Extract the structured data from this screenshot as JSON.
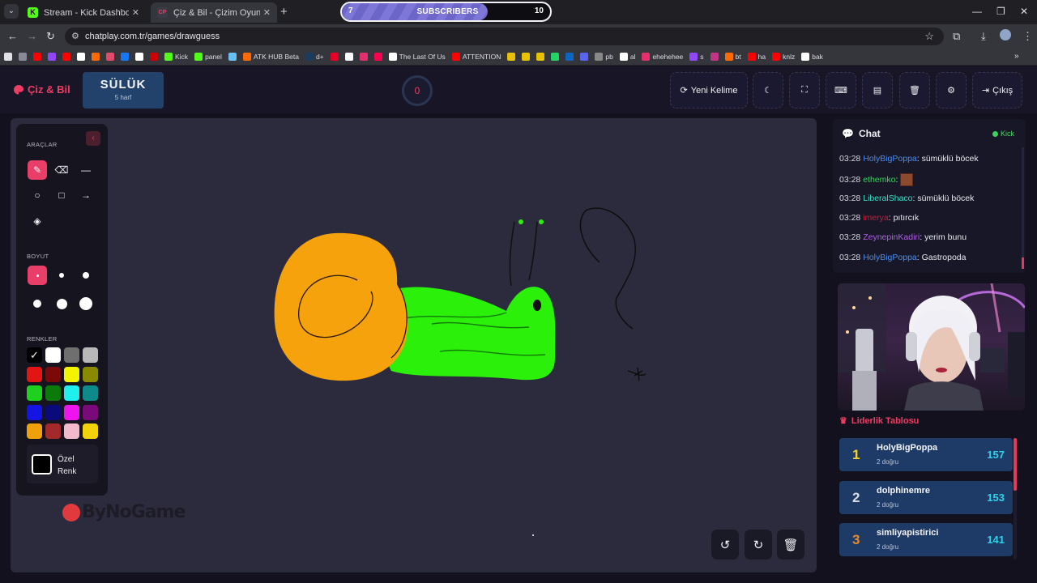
{
  "browser": {
    "tabs": [
      {
        "title": "Stream - Kick Dashboard",
        "favicon": "kick-icon",
        "color": "#53fc18",
        "active": false
      },
      {
        "title": "Çiz & Bil - Çizim Oyunu",
        "favicon": "chatplay-icon",
        "color": "#e83e67",
        "active": true
      }
    ],
    "subscribers": {
      "label": "SUBSCRIBERS",
      "current": "7",
      "goal": "10",
      "progress": 0.7
    },
    "url": "chatplay.com.tr/games/drawguess",
    "bookmarks": [
      {
        "label": "",
        "color": "#ff0000"
      },
      {
        "label": "",
        "color": "#9146ff"
      },
      {
        "label": "",
        "color": "#ff0000"
      },
      {
        "label": "",
        "color": "#ffffff"
      },
      {
        "label": "",
        "color": "#ff6a00"
      },
      {
        "label": "",
        "color": "#e34b6a"
      },
      {
        "label": "",
        "color": "#1877f2"
      },
      {
        "label": "",
        "color": "#ffffff"
      },
      {
        "label": "",
        "color": "#cc0000"
      },
      {
        "label": "Kick",
        "color": "#53fc18"
      },
      {
        "label": "panel",
        "color": "#53fc18"
      },
      {
        "label": "",
        "color": "#66c0f4"
      },
      {
        "label": "ATK HUB Beta",
        "color": "#ff6a00"
      },
      {
        "label": "d+",
        "color": "#1a3d5d"
      },
      {
        "label": "",
        "color": "#e60023"
      },
      {
        "label": "",
        "color": "#ffffff"
      },
      {
        "label": "",
        "color": "#e1306c"
      },
      {
        "label": "",
        "color": "#ff0050"
      },
      {
        "label": "The Last Of Us",
        "color": "#ffffff"
      },
      {
        "label": "ATTENTION",
        "color": "#ff0000"
      },
      {
        "label": "",
        "color": "#e6c200"
      },
      {
        "label": "",
        "color": "#e6c200"
      },
      {
        "label": "",
        "color": "#e6c200"
      },
      {
        "label": "",
        "color": "#25d366"
      },
      {
        "label": "",
        "color": "#0a66c2"
      },
      {
        "label": "",
        "color": "#5865f2"
      },
      {
        "label": "pb",
        "color": "#888888"
      },
      {
        "label": "al",
        "color": "#ffffff"
      },
      {
        "label": "ehehehee",
        "color": "#e1306c"
      },
      {
        "label": "s",
        "color": "#9146ff"
      },
      {
        "label": "",
        "color": "#c13584"
      },
      {
        "label": "bt",
        "color": "#ff6a00"
      },
      {
        "label": "ha",
        "color": "#ff0000"
      },
      {
        "label": "knlz",
        "color": "#ff0000"
      },
      {
        "label": "bak",
        "color": "#ffffff"
      }
    ]
  },
  "header": {
    "logo": "Çiz & Bil",
    "word": "SÜLÜK",
    "word_hint": "5 harf",
    "timer": "0",
    "buttons": {
      "new_word": "Yeni Kelime",
      "exit": "Çıkış"
    }
  },
  "tools": {
    "title": "ARAÇLAR",
    "size_title": "BOYUT",
    "colors_title": "RENKLER",
    "custom_color_label": "Özel Renk",
    "colors": [
      "#000000",
      "#ffffff",
      "#6f6f6f",
      "#b8b8b8",
      "#e31414",
      "#7a0a0a",
      "#f4f400",
      "#8a8a00",
      "#1fd11f",
      "#0b7a0b",
      "#1ff0ee",
      "#0f8a8a",
      "#1414e3",
      "#0a0a7a",
      "#ee14ee",
      "#7a0a7a",
      "#f0a00a",
      "#a32a2a",
      "#f2b8cc",
      "#f2d20a"
    ],
    "selected_color": "#000000"
  },
  "watermark": "ByNoGame",
  "chat": {
    "title": "Chat",
    "source": "Kick",
    "messages": [
      {
        "time": "03:28",
        "user": "HolyBigPoppa",
        "color": "#4a8df0",
        "text": "sümüklü böcek"
      },
      {
        "time": "03:28",
        "user": "ethemko",
        "color": "#3ad25b",
        "text": ""
      },
      {
        "time": "03:28",
        "user": "LiberalShaco",
        "color": "#3fe0c9",
        "text": "sümüklü böcek"
      },
      {
        "time": "03:28",
        "user": "imerya",
        "color": "#c0203a",
        "text": "pıtırcık"
      },
      {
        "time": "03:28",
        "user": "ZeynepinKadiri",
        "color": "#b25ee8",
        "text": "yerim bunu"
      },
      {
        "time": "03:28",
        "user": "HolyBigPoppa",
        "color": "#4a8df0",
        "text": "Gastropoda"
      }
    ]
  },
  "leaderboard": {
    "title": "Liderlik Tablosu",
    "entries": [
      {
        "rank": "1",
        "name": "HolyBigPoppa",
        "sub": "2 doğru",
        "score": "157",
        "rank_color": "#f4d12c"
      },
      {
        "rank": "2",
        "name": "dolphinemre",
        "sub": "2 doğru",
        "score": "153",
        "rank_color": "#d7dbe3"
      },
      {
        "rank": "3",
        "name": "simliyapistirici",
        "sub": "2 doğru",
        "score": "141",
        "rank_color": "#e8892c"
      }
    ]
  }
}
